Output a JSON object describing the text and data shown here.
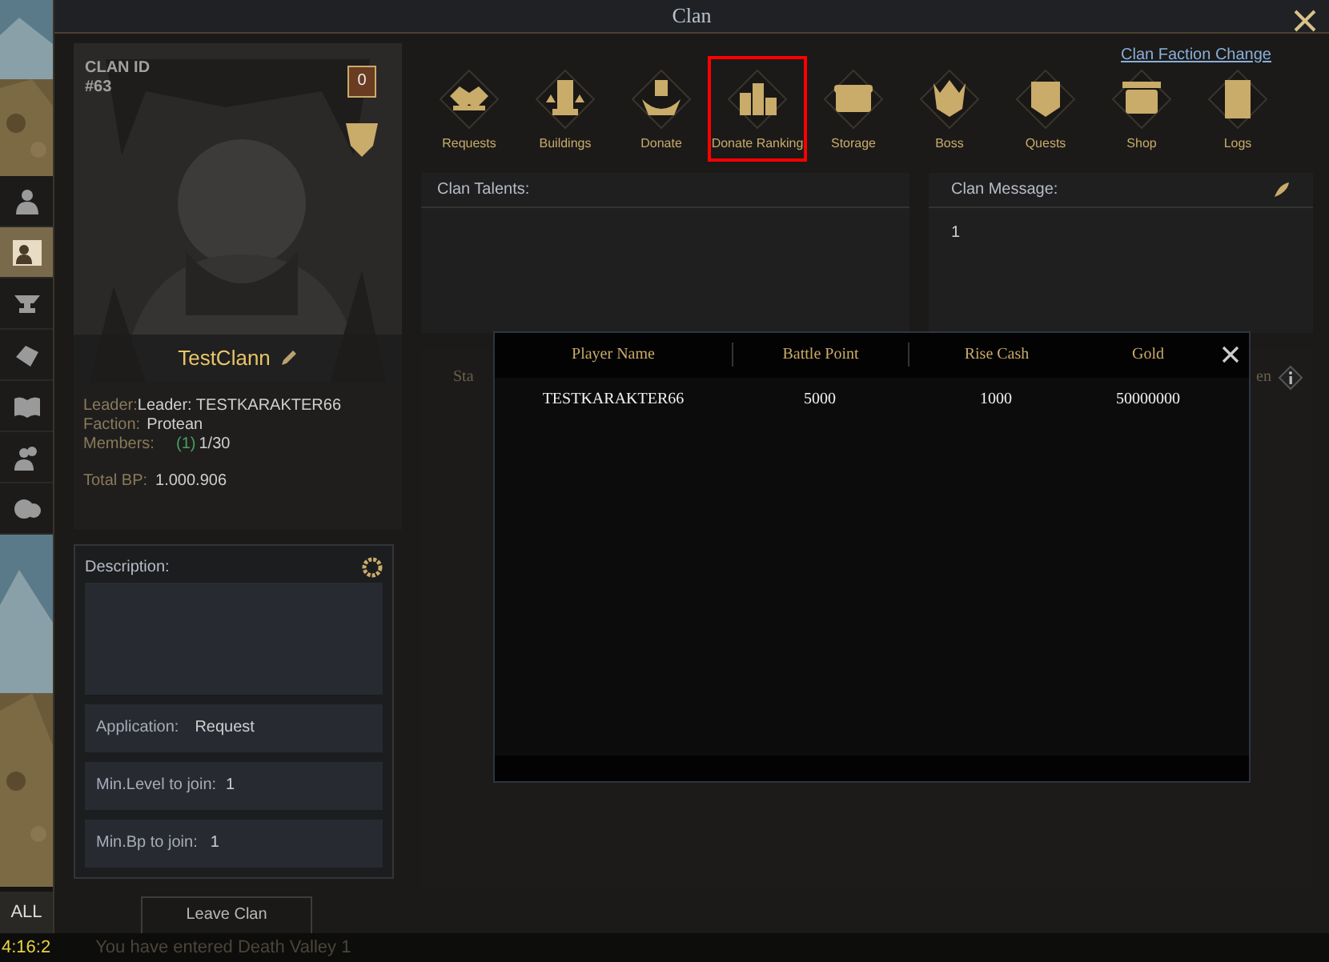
{
  "window": {
    "title": "Clan"
  },
  "side_tabs": [
    {
      "kind": "character",
      "selected": false
    },
    {
      "kind": "clan",
      "selected": true
    },
    {
      "kind": "forge",
      "selected": false
    },
    {
      "kind": "items",
      "selected": false
    },
    {
      "kind": "book",
      "selected": false
    },
    {
      "kind": "friends",
      "selected": false
    },
    {
      "kind": "emote",
      "selected": false
    }
  ],
  "clan": {
    "id_label": "CLAN ID",
    "id": "#63",
    "rank_badge": "0",
    "name": "TestClann",
    "leader_label": "Leader:",
    "leader": "Leader: TESTKARAKTER66",
    "faction_label": "Faction:",
    "faction": "Protean",
    "members_label": "Members:",
    "members_online": "(1)",
    "members": "1/30",
    "total_bp_label": "Total BP:",
    "total_bp": "1.000.906"
  },
  "details": {
    "description_label": "Description:",
    "application_label": "Application:",
    "application": "Request",
    "min_level_label": "Min.Level to join:",
    "min_level": "1",
    "min_bp_label": "Min.Bp to join:",
    "min_bp": "1"
  },
  "leave_button": "Leave Clan",
  "faction_change_link": "Clan Faction Change",
  "menu": [
    {
      "kind": "requests",
      "label": "Requests",
      "selected": false
    },
    {
      "kind": "buildings",
      "label": "Buildings",
      "selected": false
    },
    {
      "kind": "donate",
      "label": "Donate",
      "selected": false
    },
    {
      "kind": "ranking",
      "label": "Donate Ranking",
      "selected": true
    },
    {
      "kind": "storage",
      "label": "Storage",
      "selected": false
    },
    {
      "kind": "boss",
      "label": "Boss",
      "selected": false
    },
    {
      "kind": "quests",
      "label": "Quests",
      "selected": false
    },
    {
      "kind": "shop",
      "label": "Shop",
      "selected": false
    },
    {
      "kind": "logs",
      "label": "Logs",
      "selected": false
    }
  ],
  "talents": {
    "title": "Clan Talents:"
  },
  "message": {
    "title": "Clan Message:",
    "text": "1"
  },
  "members_table": {
    "column_1": "Sta",
    "column_2": "en"
  },
  "ranking_dialog": {
    "columns": [
      "Player Name",
      "Battle Point",
      "Rise Cash",
      "Gold"
    ],
    "rows": [
      [
        "TESTKARAKTER66",
        "5000",
        "1000",
        "50000000"
      ]
    ]
  },
  "chat": {
    "tab": "ALL",
    "time": "4:16:2",
    "message": "You have entered Death Valley 1"
  }
}
